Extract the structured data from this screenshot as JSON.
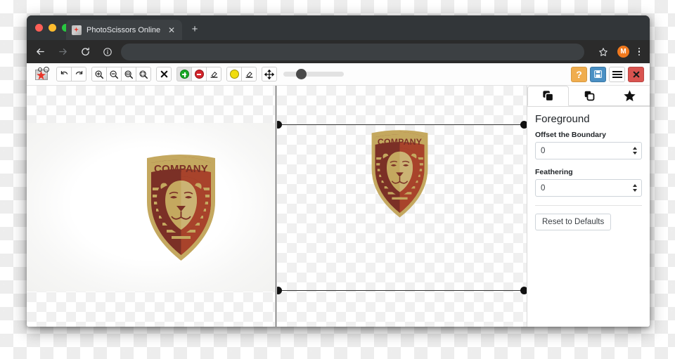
{
  "browser": {
    "tab": {
      "title": "PhotoScissors Online",
      "favicon_name": "photoscissors-favicon",
      "close_label": "✕"
    },
    "new_tab_label": "+",
    "nav": {
      "back_label": "←",
      "forward_label": "→",
      "reload_label": "↻",
      "info_label": "ⓘ",
      "bookmark_label": "☆",
      "avatar_initial": "M",
      "menu_label": "⋮"
    }
  },
  "app": {
    "toolbar": {
      "logo_name": "photoscissors-logo",
      "buttons": [
        {
          "name": "undo-button",
          "label": "Undo"
        },
        {
          "name": "redo-button",
          "label": "Redo"
        },
        {
          "name": "zoom-in-button",
          "label": "Zoom In"
        },
        {
          "name": "zoom-out-button",
          "label": "Zoom Out"
        },
        {
          "name": "zoom-actual-button",
          "label": "Actual Size"
        },
        {
          "name": "zoom-fit-button",
          "label": "Fit to Window"
        },
        {
          "name": "clear-markers-button",
          "label": "Clear Markers"
        },
        {
          "name": "foreground-marker-button",
          "label": "Foreground Marker"
        },
        {
          "name": "background-marker-button",
          "label": "Background Marker"
        },
        {
          "name": "marker-eraser-button",
          "label": "Eraser"
        },
        {
          "name": "hair-marker-button",
          "label": "Hair / Soft Edge Marker"
        },
        {
          "name": "hair-eraser-button",
          "label": "Hair Eraser"
        },
        {
          "name": "pan-button",
          "label": "Pan"
        }
      ],
      "brush_size_slider": {
        "name": "brush-size-slider",
        "value": 22,
        "min": 0,
        "max": 100
      },
      "right_buttons": [
        {
          "name": "help-button",
          "label": "?",
          "color": "#f0ad4e"
        },
        {
          "name": "save-button",
          "label": "Save",
          "color": "#4a90c4"
        },
        {
          "name": "menu-button",
          "label": "Menu",
          "color": "#ffffff"
        },
        {
          "name": "close-button",
          "label": "✕",
          "color": "#d9534f"
        }
      ]
    },
    "editor": {
      "left_pane_name": "source-image-pane",
      "right_pane_name": "result-image-pane",
      "image_alt": "COMPANY lion crest logo",
      "crest_text": "COMPANY",
      "selection_handles": 4
    },
    "panel": {
      "tabs": [
        {
          "name": "tab-foreground",
          "icon": "layers-filled-icon"
        },
        {
          "name": "tab-background",
          "icon": "layers-outline-icon"
        },
        {
          "name": "tab-effects",
          "icon": "star-icon"
        }
      ],
      "active_tab_index": 0,
      "title": "Foreground",
      "fields": [
        {
          "name": "offset-the-boundary-field",
          "label": "Offset the Boundary",
          "value": "0"
        },
        {
          "name": "feathering-field",
          "label": "Feathering",
          "value": "0"
        }
      ],
      "reset_label": "Reset to Defaults"
    }
  },
  "colors": {
    "accent_orange": "#f0791e",
    "help_yellow": "#f0ad4e",
    "save_blue": "#4a90c4",
    "close_red": "#d9534f",
    "crest_gold": "#c4a85f",
    "crest_dark_red": "#7b3026",
    "crest_red": "#a8432b"
  }
}
